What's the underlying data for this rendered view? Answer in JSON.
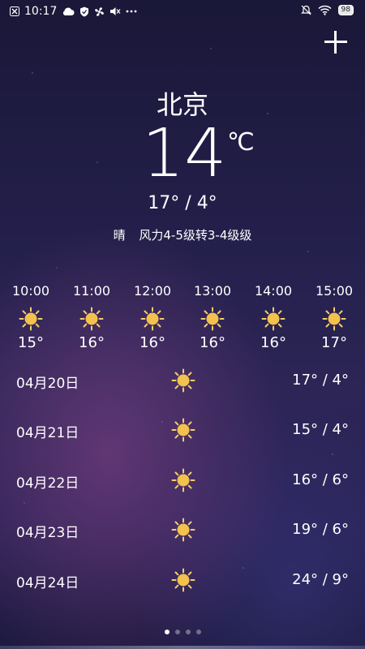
{
  "status_bar": {
    "time": "10:17",
    "battery": "98",
    "icons": [
      "close-icon",
      "cloud-icon",
      "shield-icon",
      "fan-icon",
      "mute-icon",
      "more-icon",
      "alarm-off-icon",
      "wifi-icon",
      "battery-icon"
    ]
  },
  "weather": {
    "city": "北京",
    "temperature": "14",
    "unit": "℃",
    "range": "17° / 4°",
    "condition": "晴",
    "wind": "风力4-5级转3-4级级"
  },
  "hourly": [
    {
      "time": "10:00",
      "icon": "sun-icon",
      "temp": "15°"
    },
    {
      "time": "11:00",
      "icon": "sun-icon",
      "temp": "16°"
    },
    {
      "time": "12:00",
      "icon": "sun-icon",
      "temp": "16°"
    },
    {
      "time": "13:00",
      "icon": "sun-icon",
      "temp": "16°"
    },
    {
      "time": "14:00",
      "icon": "sun-icon",
      "temp": "16°"
    },
    {
      "time": "15:00",
      "icon": "sun-icon",
      "temp": "17°"
    }
  ],
  "daily": [
    {
      "date": "04月20日",
      "icon": "sun-icon",
      "range": "17° / 4°"
    },
    {
      "date": "04月21日",
      "icon": "sun-icon",
      "range": "15° / 4°"
    },
    {
      "date": "04月22日",
      "icon": "sun-icon",
      "range": "16° / 6°"
    },
    {
      "date": "04月23日",
      "icon": "sun-icon",
      "range": "19° / 6°"
    },
    {
      "date": "04月24日",
      "icon": "sun-icon",
      "range": "24° / 9°"
    }
  ],
  "pager": {
    "count": 4,
    "active": 0
  },
  "colors": {
    "sun": "#f2c14e",
    "sun_rays": "#f5cf6a",
    "background_top": "#1a1738",
    "background_mid": "#2c2556"
  }
}
